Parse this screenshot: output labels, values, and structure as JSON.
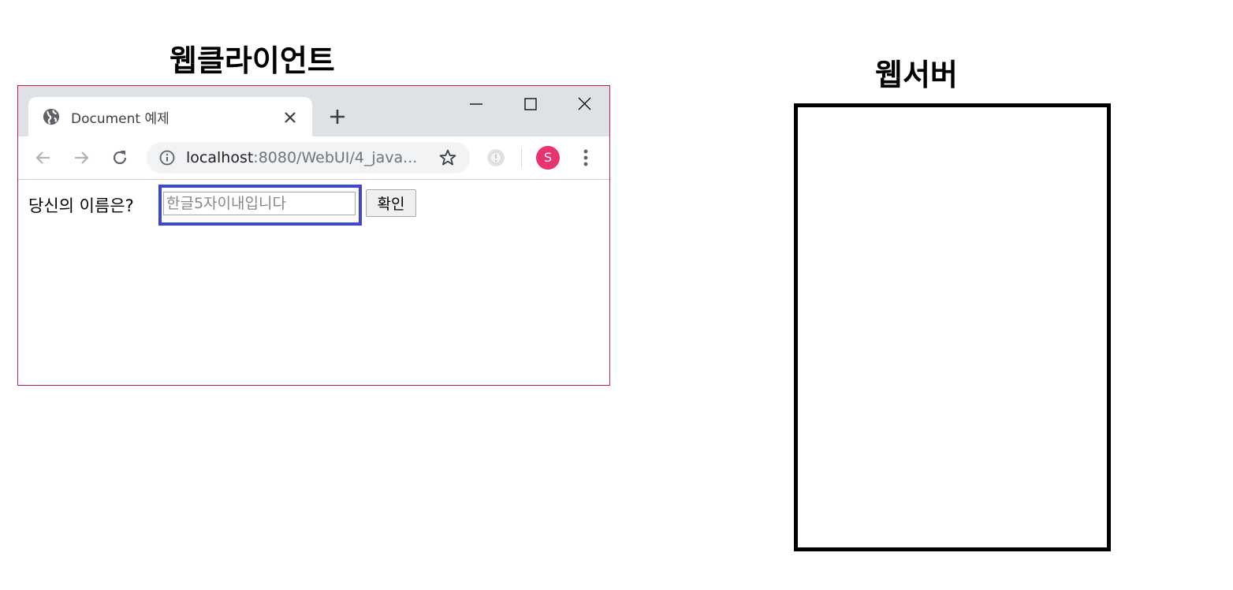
{
  "labels": {
    "client": "웹클라이언트",
    "server": "웹서버"
  },
  "browser": {
    "tab_title": "Document 예제",
    "url_host": "localhost",
    "url_path": ":8080/WebUI/4_java...",
    "profile_initial": "S"
  },
  "page": {
    "question": "당신의 이름은?",
    "input_placeholder": "한글5자이내입니다",
    "input_value": "",
    "confirm_label": "확인"
  },
  "colors": {
    "browser_border": "#c2185b",
    "input_highlight": "#3f48cc",
    "avatar": "#e8336f"
  },
  "icons": [
    "globe-icon",
    "close-icon",
    "plus-icon",
    "minimize-icon",
    "maximize-icon",
    "back-arrow-icon",
    "forward-arrow-icon",
    "reload-icon",
    "info-icon",
    "star-icon",
    "extension-icon",
    "kebab-menu-icon"
  ]
}
